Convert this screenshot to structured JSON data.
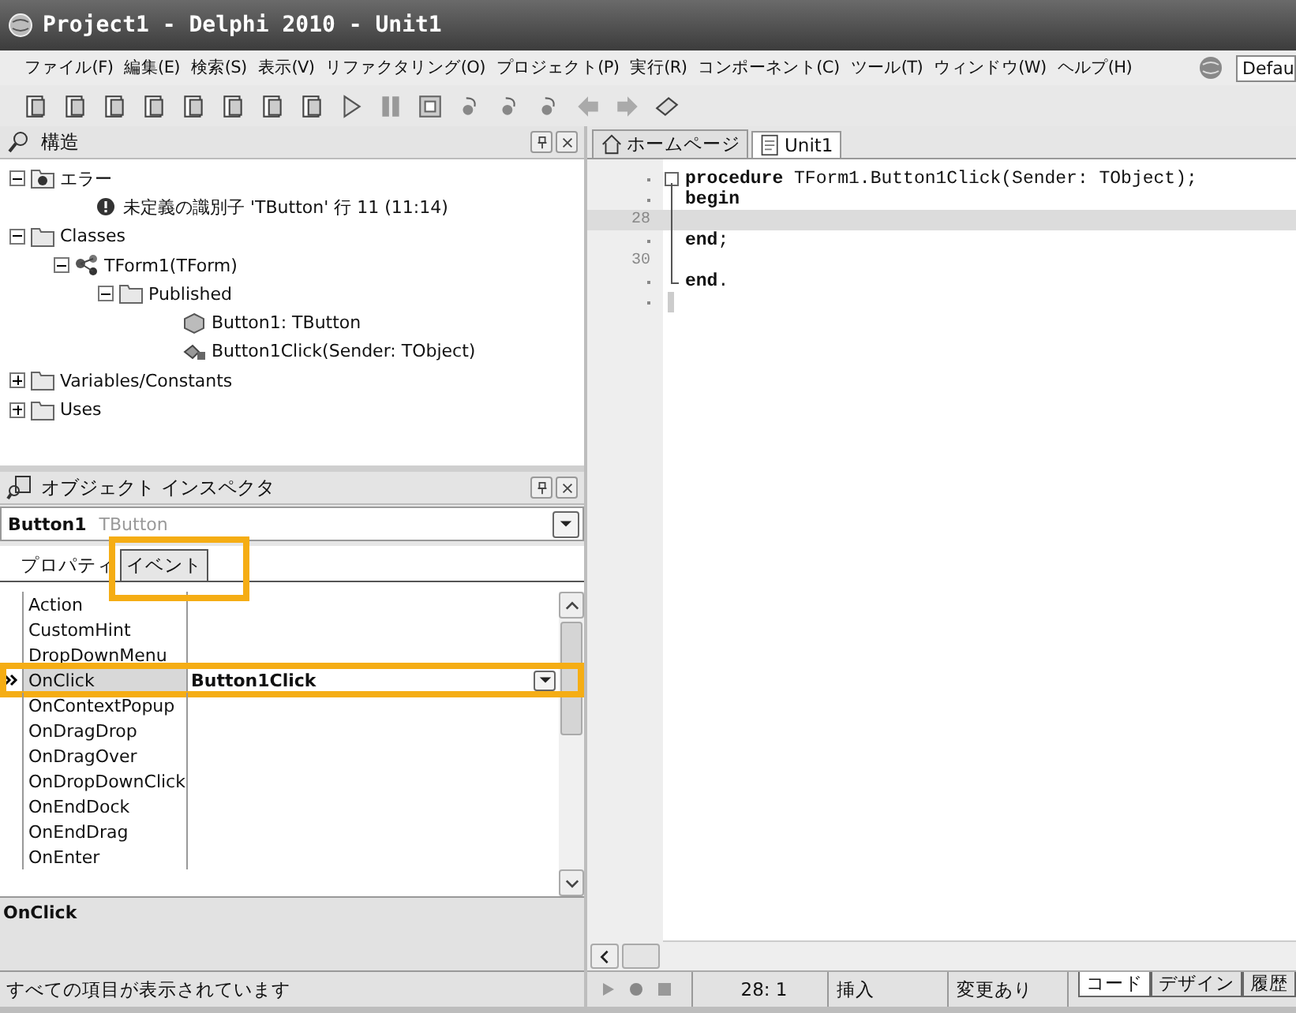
{
  "window": {
    "title": "Project1 - Delphi 2010 - Unit1"
  },
  "menu": [
    "ファイル(F)",
    "編集(E)",
    "検索(S)",
    "表示(V)",
    "リファクタリング(O)",
    "プロジェクト(P)",
    "実行(R)",
    "コンポーネント(C)",
    "ツール(T)",
    "ウィンドウ(W)",
    "ヘルプ(H)"
  ],
  "layout_combo": {
    "value": "Defau"
  },
  "structure": {
    "title": "構造",
    "tree": [
      {
        "label": "エラー",
        "kind": "error-folder",
        "expanded": true,
        "children": [
          {
            "label": "未定義の識別子 'TButton' 行 11 (11:14)",
            "kind": "error"
          }
        ]
      },
      {
        "label": "Classes",
        "kind": "folder",
        "expanded": true,
        "children": [
          {
            "label": "TForm1(TForm)",
            "kind": "class",
            "expanded": true,
            "children": [
              {
                "label": "Published",
                "kind": "folder",
                "expanded": true,
                "children": [
                  {
                    "label": "Button1: TButton",
                    "kind": "field"
                  },
                  {
                    "label": "Button1Click(Sender: TObject)",
                    "kind": "method"
                  }
                ]
              }
            ]
          }
        ]
      },
      {
        "label": "Variables/Constants",
        "kind": "folder",
        "expanded": false
      },
      {
        "label": "Uses",
        "kind": "folder",
        "expanded": false
      }
    ]
  },
  "inspector": {
    "title": "オブジェクト インスペクタ",
    "object_name": "Button1",
    "object_type": "TButton",
    "tabs": [
      {
        "label": "プロパティ",
        "selected": false,
        "highlighted": false
      },
      {
        "label": "イベント",
        "selected": true,
        "highlighted": true
      }
    ],
    "rows": [
      {
        "name": "Action",
        "selected": false,
        "highlighted": false
      },
      {
        "name": "CustomHint",
        "selected": false,
        "highlighted": false
      },
      {
        "name": "DropDownMenu",
        "selected": false,
        "highlighted": false
      },
      {
        "name": "OnClick",
        "value": "Button1Click",
        "selected": true,
        "highlighted": true
      },
      {
        "name": "OnContextPopup",
        "selected": false,
        "highlighted": false
      },
      {
        "name": "OnDragDrop",
        "selected": false,
        "highlighted": false
      },
      {
        "name": "OnDragOver",
        "selected": false,
        "highlighted": false
      },
      {
        "name": "OnDropDownClick",
        "selected": false,
        "highlighted": false
      },
      {
        "name": "OnEndDock",
        "selected": false,
        "highlighted": false
      },
      {
        "name": "OnEndDrag",
        "selected": false,
        "highlighted": false
      },
      {
        "name": "OnEnter",
        "selected": false,
        "highlighted": false
      }
    ],
    "description": "OnClick",
    "status": "すべての項目が表示されています"
  },
  "editor": {
    "tabs": [
      {
        "label": "ホームページ",
        "selected": false
      },
      {
        "label": "Unit1",
        "selected": true
      }
    ],
    "lines": [
      {
        "code": "**procedure** TForm1.Button1Click(Sender: TObject);",
        "kind": "fold-start",
        "current": false
      },
      {
        "code": "**begin**",
        "kind": "fold-line",
        "current": false
      },
      {
        "number": "28",
        "kind": "fold-line",
        "current": true
      },
      {
        "code": "**end**;",
        "kind": "fold-line",
        "current": false
      },
      {
        "number": "30",
        "kind": "fold-line",
        "current": false
      },
      {
        "code": "**end**.",
        "kind": "fold-end",
        "current": false
      },
      {
        "kind": "caret",
        "current": false
      }
    ]
  },
  "status_bar": {
    "position": "28:  1",
    "mode": "挿入",
    "modified": "変更あり",
    "view_tabs": [
      {
        "label": "コード",
        "selected": true
      },
      {
        "label": "デザイン",
        "selected": false
      },
      {
        "label": "履歴",
        "selected": false
      }
    ]
  }
}
